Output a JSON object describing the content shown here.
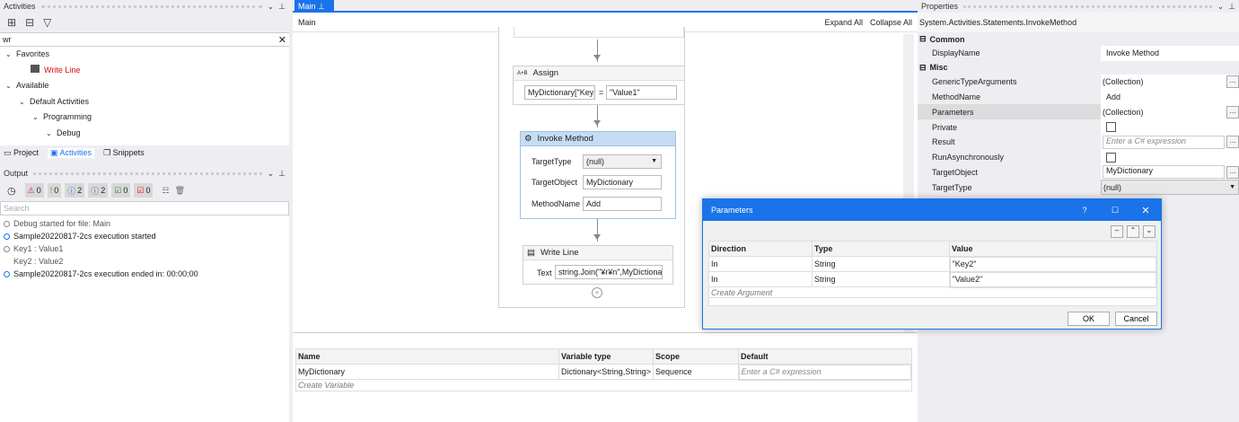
{
  "activities": {
    "title": "Activities",
    "search_value": "wr",
    "tree": [
      {
        "label": "Favorites"
      },
      {
        "label": "Write Line"
      },
      {
        "label": "Available"
      },
      {
        "label": "Default Activities"
      },
      {
        "label": "Programming"
      },
      {
        "label": "Debug"
      }
    ],
    "tabs": [
      "Project",
      "Activities",
      "Snippets"
    ]
  },
  "output": {
    "title": "Output",
    "filters": [
      {
        "icon": "warning-icon",
        "count": "0",
        "color": "#e81123"
      },
      {
        "icon": "error-icon",
        "count": "0",
        "color": "#c1651b"
      },
      {
        "icon": "info-icon",
        "count": "2",
        "color": "#1a73e8"
      },
      {
        "icon": "trace-icon",
        "count": "2",
        "color": "#555555"
      },
      {
        "icon": "success-icon",
        "count": "0",
        "color": "#2e8b2e"
      },
      {
        "icon": "fail-icon",
        "count": "0",
        "color": "#e81123"
      }
    ],
    "search_placeholder": "Search",
    "log": [
      "Debug started for file: Main",
      "Sample20220817-2cs execution started",
      "Key1 : Value1",
      "Key2 : Value2",
      "Sample20220817-2cs execution ended in: 00:00:00"
    ]
  },
  "designer": {
    "tab": "Main",
    "breadcrumb": "Main",
    "expand_all": "Expand All",
    "collapse_all": "Collapse All",
    "assign": {
      "title": "Assign",
      "icon_text": "A+B",
      "to": "MyDictionary[\"Key",
      "eq": "=",
      "value": "\"Value1\""
    },
    "invoke": {
      "title": "Invoke Method",
      "target_type_label": "TargetType",
      "target_type": "(null)",
      "target_object_label": "TargetObject",
      "target_object": "MyDictionary",
      "method_name_label": "MethodName",
      "method_name": "Add"
    },
    "writeline": {
      "title": "Write Line",
      "text_label": "Text",
      "text": "string.Join(\"¥r¥n\",MyDictiona"
    }
  },
  "variables": {
    "headers": [
      "Name",
      "Variable type",
      "Scope",
      "Default"
    ],
    "rows": [
      {
        "name": "MyDictionary",
        "type": "Dictionary<String,String>",
        "scope": "Sequence",
        "default_placeholder": "Enter a C# expression"
      }
    ],
    "create": "Create Variable"
  },
  "properties": {
    "title": "Properties",
    "type_name": "System.Activities.Statements.InvokeMethod",
    "sections": [
      {
        "name": "Common"
      },
      {
        "name": "Misc"
      }
    ],
    "rows": [
      {
        "k": "DisplayName",
        "v": "Invoke Method"
      },
      {
        "k": "GenericTypeArguments",
        "v": "(Collection)"
      },
      {
        "k": "MethodName",
        "v": "Add"
      },
      {
        "k": "Parameters",
        "v": "(Collection)"
      },
      {
        "k": "Private",
        "v": ""
      },
      {
        "k": "Result",
        "v": "Enter a C# expression"
      },
      {
        "k": "RunAsynchronously",
        "v": ""
      },
      {
        "k": "TargetObject",
        "v": "MyDictionary"
      },
      {
        "k": "TargetType",
        "v": "(null)"
      }
    ]
  },
  "dialog": {
    "title": "Parameters",
    "help": "?",
    "headers": [
      "Direction",
      "Type",
      "Value"
    ],
    "rows": [
      {
        "dir": "In",
        "type": "String",
        "value": "\"Key2\""
      },
      {
        "dir": "In",
        "type": "String",
        "value": "\"Value2\""
      }
    ],
    "create": "Create Argument",
    "ok": "OK",
    "cancel": "Cancel"
  }
}
